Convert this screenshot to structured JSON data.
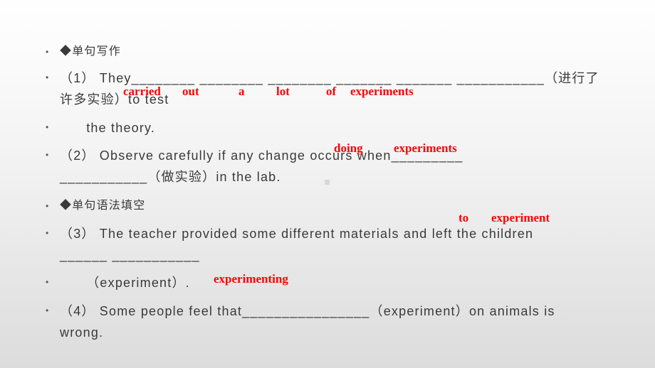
{
  "slide": {
    "background_top": "#fefefe",
    "background_bottom": "#dcdcdc",
    "text_color": "#3a3a3a",
    "answer_color": "#ff0000",
    "bullet_glyph": "•",
    "lines": [
      "◆单句写作",
      "（1） They________ ________ ________ _______ _______ ___________（进行了",
      "许多实验）to test",
      "      the theory.",
      "（2） Observe carefully if any change occurs when_________",
      "___________（做实验）in the lab.",
      "◆单句语法填空",
      "（3） The teacher provided some different materials and left the children",
      "______ ___________",
      "      （experiment）.",
      "（4） Some people feel that________________（experiment）on animals is",
      "wrong."
    ],
    "answers": {
      "q1": [
        "carried",
        "out",
        "a",
        "lot",
        "of",
        "experiments"
      ],
      "q2": [
        "doing",
        "experiments"
      ],
      "q3": [
        "to",
        "experiment"
      ],
      "q3b": "experimenting"
    }
  }
}
